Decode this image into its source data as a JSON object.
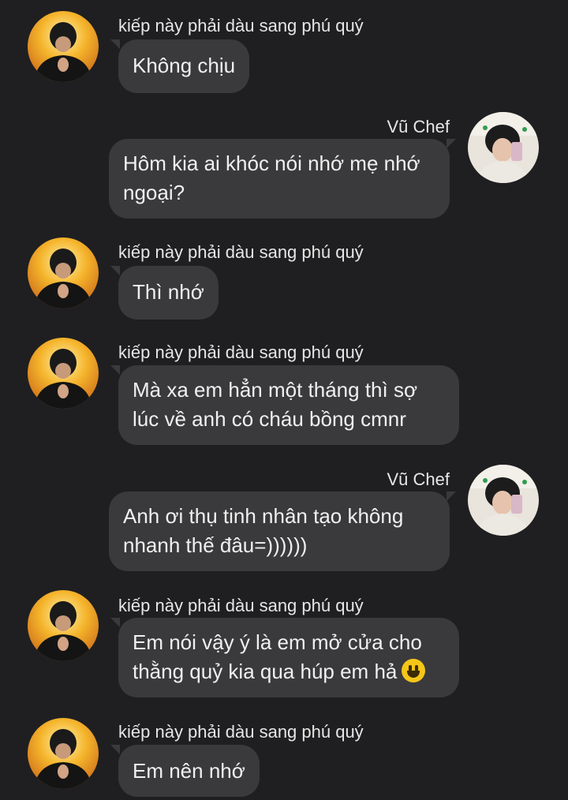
{
  "messages": [
    {
      "sender": "kiếp này phải dàu sang phú quý",
      "lines": [
        "Không chịu"
      ]
    },
    {
      "sender": "Vũ Chef",
      "lines": [
        "Hôm kia ai khóc nói nhớ mẹ nhớ",
        "ngoại?"
      ]
    },
    {
      "sender": "kiếp này phải dàu sang phú quý",
      "lines": [
        "Thì nhớ"
      ]
    },
    {
      "sender": "kiếp này phải dàu sang phú quý",
      "lines": [
        "Mà xa em hẳn một tháng thì sợ",
        "lúc về anh có cháu bồng cmnr"
      ]
    },
    {
      "sender": "Vũ Chef",
      "lines": [
        "Anh ơi thụ tinh nhân tạo không",
        "nhanh thế đâu=))))))"
      ]
    },
    {
      "sender": "kiếp này phải dàu sang phú quý",
      "lines": [
        "Em nói vậy ý là em mở cửa cho",
        "thằng quỷ kia qua húp em hả"
      ],
      "emoji": "grinning-face-emoji"
    },
    {
      "sender": "kiếp này phải dàu sang phú quý",
      "lines": [
        "Em nên nhớ"
      ]
    }
  ],
  "colors": {
    "background": "#1f1f21",
    "bubble": "#3a3a3c",
    "text": "#f0f0f0"
  },
  "icons": {
    "left_avatar": "avatar-photo-person-black-hood",
    "right_avatar": "avatar-photo-person-selfie"
  }
}
